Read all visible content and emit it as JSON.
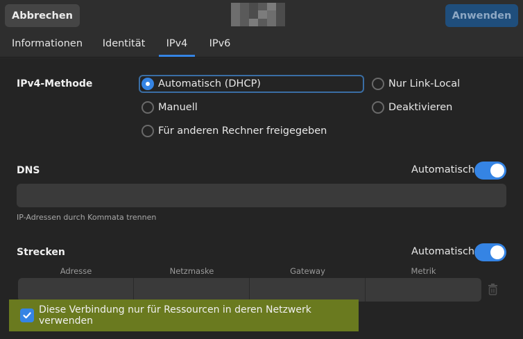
{
  "header": {
    "cancel_label": "Abbrechen",
    "apply_label": "Anwenden"
  },
  "tabs": [
    {
      "label": "Informationen"
    },
    {
      "label": "Identität"
    },
    {
      "label": "IPv4"
    },
    {
      "label": "IPv6"
    }
  ],
  "active_tab": "IPv4",
  "ipv4_method": {
    "label": "IPv4-Methode",
    "options": [
      {
        "label": "Automatisch (DHCP)",
        "checked": true
      },
      {
        "label": "Nur Link-Local",
        "checked": false
      },
      {
        "label": "Manuell",
        "checked": false
      },
      {
        "label": "Deaktivieren",
        "checked": false
      },
      {
        "label": "Für anderen Rechner freigegeben",
        "checked": false
      }
    ]
  },
  "dns": {
    "label": "DNS",
    "auto_label": "Automatisch",
    "auto_on": true,
    "value": "",
    "hint": "IP-Adressen durch Kommata trennen"
  },
  "routes": {
    "label": "Strecken",
    "auto_label": "Automatisch",
    "auto_on": true,
    "columns": [
      "Adresse",
      "Netzmaske",
      "Gateway",
      "Metrik"
    ]
  },
  "restrict": {
    "label": "Diese Verbindung nur für Ressourcen in deren Netzwerk verwenden",
    "checked": true
  },
  "colors": {
    "accent": "#3584e4",
    "banner": "#6a7a1f"
  }
}
